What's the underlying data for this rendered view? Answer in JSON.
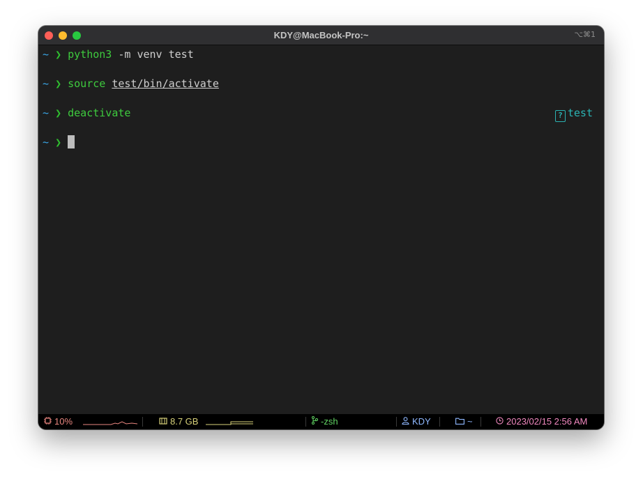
{
  "window": {
    "title": "KDY@MacBook-Pro:~",
    "shortcut": "⌥⌘1"
  },
  "terminal": {
    "lines": [
      {
        "prompt_dir": "~",
        "prompt_arrow": "❯",
        "command": "python3",
        "args": " -m venv test",
        "path": ""
      },
      {
        "prompt_dir": "~",
        "prompt_arrow": "❯",
        "command": "source",
        "args": " ",
        "path": "test/bin/activate"
      },
      {
        "prompt_dir": "~",
        "prompt_arrow": "❯",
        "command": "deactivate",
        "args": "",
        "path": ""
      },
      {
        "prompt_dir": "~",
        "prompt_arrow": "❯",
        "command": "",
        "args": "",
        "path": ""
      }
    ],
    "venv_indicator": {
      "icon": "?",
      "name": "test"
    }
  },
  "status_bar": {
    "cpu": {
      "icon": "cpu-icon",
      "label": "10%"
    },
    "memory": {
      "icon": "memory-icon",
      "label": "8.7 GB"
    },
    "job": {
      "icon": "branch-icon",
      "label": "-zsh"
    },
    "user": {
      "icon": "user-icon",
      "label": "KDY"
    },
    "directory": {
      "icon": "folder-icon",
      "label": "~"
    },
    "clock": {
      "icon": "clock-icon",
      "label": "2023/02/15 2:56 AM"
    }
  },
  "colors": {
    "background": "#1e1e1e",
    "prompt_dir": "#3aa7e8",
    "prompt_arrow": "#2fc02f",
    "command": "#3ecb3e",
    "venv": "#2bb4b4"
  }
}
